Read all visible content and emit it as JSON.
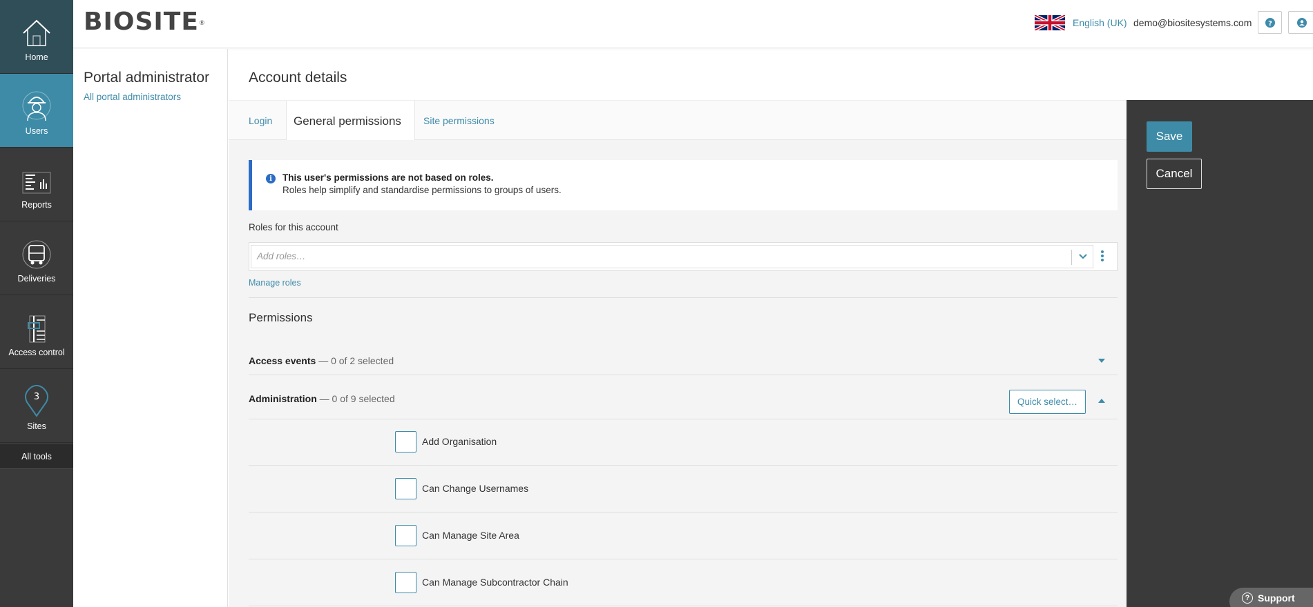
{
  "nav": {
    "items": [
      {
        "label": "Home",
        "icon": "home-icon"
      },
      {
        "label": "Users",
        "icon": "worker-icon"
      },
      {
        "label": "Reports",
        "icon": "reports-icon"
      },
      {
        "label": "Deliveries",
        "icon": "truck-icon"
      },
      {
        "label": "Access control",
        "icon": "turnstile-icon"
      },
      {
        "label": "Sites",
        "icon": "map-pin-icon"
      }
    ],
    "all_tools": "All tools",
    "active": "Users"
  },
  "header": {
    "logo": "BIOSITE",
    "logo_mark": "®",
    "language": "English (UK)",
    "email": "demo@biositesystems.com"
  },
  "side": {
    "title": "Portal administrator",
    "link": "All portal administrators"
  },
  "main": {
    "title": "Account details",
    "tabs": [
      {
        "label": "Login"
      },
      {
        "label": "General permissions"
      },
      {
        "label": "Site permissions"
      }
    ],
    "info": {
      "bold": "This user's permissions are not based on roles.",
      "text": "Roles help simplify and standardise permissions to groups of users."
    },
    "roles": {
      "label": "Roles for this account",
      "placeholder": "Add roles…",
      "manage": "Manage roles"
    },
    "permissions": {
      "title": "Permissions",
      "groups": [
        {
          "name": "Access events",
          "count": "— 0 of 2 selected"
        },
        {
          "name": "Administration",
          "count": "— 0 of 9 selected",
          "quick_select": "Quick select…"
        }
      ],
      "items": [
        "Add Organisation",
        "Can Change Usernames",
        "Can Manage Site Area",
        "Can Manage Subcontractor Chain"
      ]
    }
  },
  "actions": {
    "save": "Save",
    "cancel": "Cancel"
  },
  "support": "Support",
  "colors": {
    "accent": "#3e8ba7",
    "link": "#3d8bab",
    "nav_bg": "#3a3a3a",
    "info_border": "#2c6cc4"
  }
}
